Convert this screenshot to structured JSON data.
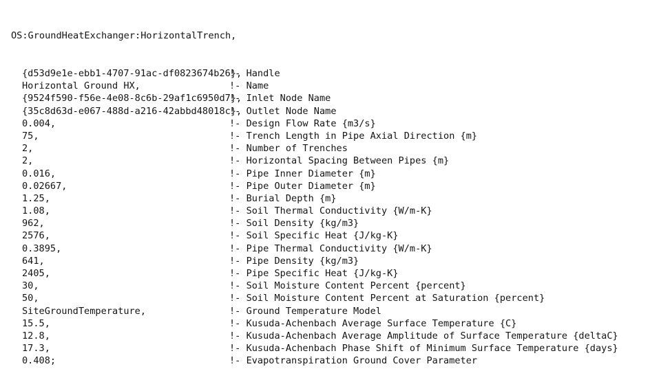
{
  "document": {
    "object_type": "OS:GroundHeatExchanger:HorizontalTrench,",
    "comment_marker": "!-",
    "terminator": ";",
    "separator": ",",
    "colors": {
      "background": "#ffffff",
      "text": "#141414"
    }
  },
  "fields": [
    {
      "value": "{d53d9e1e-ebb1-4707-91ac-df0823674b26},",
      "comment": "Handle"
    },
    {
      "value": "Horizontal Ground HX,",
      "comment": "Name"
    },
    {
      "value": "{9524f590-f56e-4e08-8c6b-29af1c6950d7},",
      "comment": "Inlet Node Name"
    },
    {
      "value": "{35c8d63d-e067-488d-a216-42abbd48018c},",
      "comment": "Outlet Node Name"
    },
    {
      "value": "0.004,",
      "comment": "Design Flow Rate {m3/s}"
    },
    {
      "value": "75,",
      "comment": "Trench Length in Pipe Axial Direction {m}"
    },
    {
      "value": "2,",
      "comment": "Number of Trenches"
    },
    {
      "value": "2,",
      "comment": "Horizontal Spacing Between Pipes {m}"
    },
    {
      "value": "0.016,",
      "comment": "Pipe Inner Diameter {m}"
    },
    {
      "value": "0.02667,",
      "comment": "Pipe Outer Diameter {m}"
    },
    {
      "value": "1.25,",
      "comment": "Burial Depth {m}"
    },
    {
      "value": "1.08,",
      "comment": "Soil Thermal Conductivity {W/m-K}"
    },
    {
      "value": "962,",
      "comment": "Soil Density {kg/m3}"
    },
    {
      "value": "2576,",
      "comment": "Soil Specific Heat {J/kg-K}"
    },
    {
      "value": "0.3895,",
      "comment": "Pipe Thermal Conductivity {W/m-K}"
    },
    {
      "value": "641,",
      "comment": "Pipe Density {kg/m3}"
    },
    {
      "value": "2405,",
      "comment": "Pipe Specific Heat {J/kg-K}"
    },
    {
      "value": "30,",
      "comment": "Soil Moisture Content Percent {percent}"
    },
    {
      "value": "50,",
      "comment": "Soil Moisture Content Percent at Saturation {percent}"
    },
    {
      "value": "SiteGroundTemperature,",
      "comment": "Ground Temperature Model"
    },
    {
      "value": "15.5,",
      "comment": "Kusuda-Achenbach Average Surface Temperature {C}"
    },
    {
      "value": "12.8,",
      "comment": "Kusuda-Achenbach Average Amplitude of Surface Temperature {deltaC}"
    },
    {
      "value": "17.3,",
      "comment": "Kusuda-Achenbach Phase Shift of Minimum Surface Temperature {days}"
    },
    {
      "value": "0.408;",
      "comment": "Evapotranspiration Ground Cover Parameter"
    }
  ]
}
